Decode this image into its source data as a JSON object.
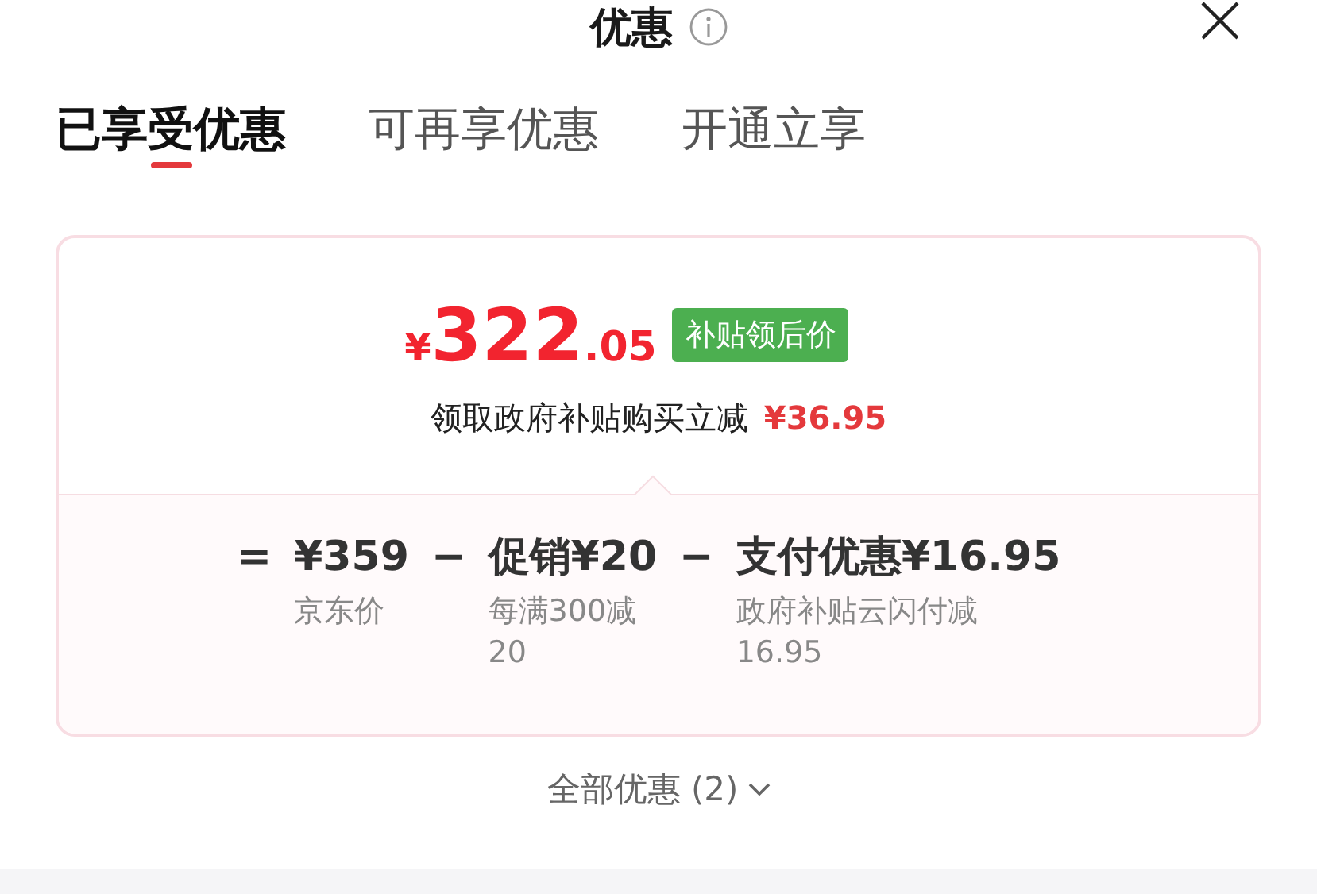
{
  "header": {
    "title": "优惠"
  },
  "tabs": [
    {
      "label": "已享受优惠",
      "selected": true
    },
    {
      "label": "可再享优惠",
      "selected": false
    },
    {
      "label": "开通立享",
      "selected": false
    }
  ],
  "summary": {
    "currency": "¥",
    "integer": "322",
    "decimal": ".05",
    "badge": "补贴领后价",
    "subtitle": "领取政府补贴购买立减",
    "saving": "¥36.95"
  },
  "breakdown": [
    {
      "operator": "=",
      "amount": "¥359",
      "note": "京东价"
    },
    {
      "operator": "−",
      "amount": "促销¥20",
      "note": "每满300减20"
    },
    {
      "operator": "−",
      "amount": "支付优惠¥16.95",
      "note": "政府补贴云闪付减16.95"
    }
  ],
  "footer": {
    "label": "全部优惠 (2)"
  }
}
